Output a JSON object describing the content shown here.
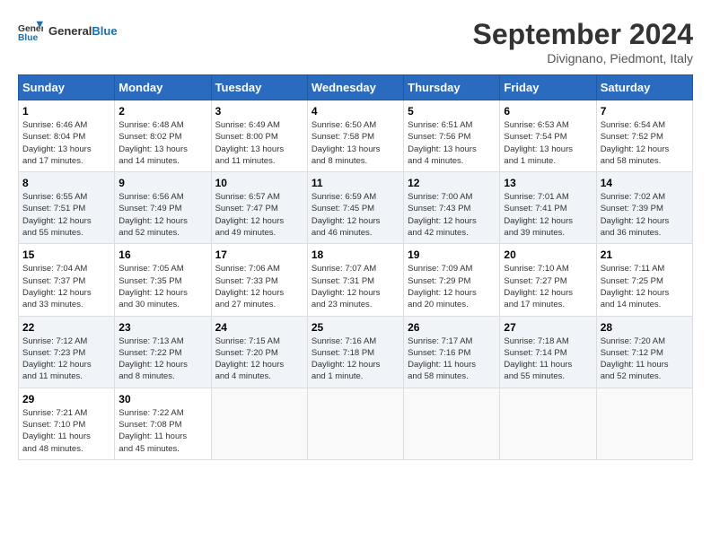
{
  "header": {
    "logo_line1": "General",
    "logo_line2": "Blue",
    "month": "September 2024",
    "location": "Divignano, Piedmont, Italy"
  },
  "columns": [
    "Sunday",
    "Monday",
    "Tuesday",
    "Wednesday",
    "Thursday",
    "Friday",
    "Saturday"
  ],
  "rows": [
    [
      {
        "day": "1",
        "info": "Sunrise: 6:46 AM\nSunset: 8:04 PM\nDaylight: 13 hours\nand 17 minutes."
      },
      {
        "day": "2",
        "info": "Sunrise: 6:48 AM\nSunset: 8:02 PM\nDaylight: 13 hours\nand 14 minutes."
      },
      {
        "day": "3",
        "info": "Sunrise: 6:49 AM\nSunset: 8:00 PM\nDaylight: 13 hours\nand 11 minutes."
      },
      {
        "day": "4",
        "info": "Sunrise: 6:50 AM\nSunset: 7:58 PM\nDaylight: 13 hours\nand 8 minutes."
      },
      {
        "day": "5",
        "info": "Sunrise: 6:51 AM\nSunset: 7:56 PM\nDaylight: 13 hours\nand 4 minutes."
      },
      {
        "day": "6",
        "info": "Sunrise: 6:53 AM\nSunset: 7:54 PM\nDaylight: 13 hours\nand 1 minute."
      },
      {
        "day": "7",
        "info": "Sunrise: 6:54 AM\nSunset: 7:52 PM\nDaylight: 12 hours\nand 58 minutes."
      }
    ],
    [
      {
        "day": "8",
        "info": "Sunrise: 6:55 AM\nSunset: 7:51 PM\nDaylight: 12 hours\nand 55 minutes."
      },
      {
        "day": "9",
        "info": "Sunrise: 6:56 AM\nSunset: 7:49 PM\nDaylight: 12 hours\nand 52 minutes."
      },
      {
        "day": "10",
        "info": "Sunrise: 6:57 AM\nSunset: 7:47 PM\nDaylight: 12 hours\nand 49 minutes."
      },
      {
        "day": "11",
        "info": "Sunrise: 6:59 AM\nSunset: 7:45 PM\nDaylight: 12 hours\nand 46 minutes."
      },
      {
        "day": "12",
        "info": "Sunrise: 7:00 AM\nSunset: 7:43 PM\nDaylight: 12 hours\nand 42 minutes."
      },
      {
        "day": "13",
        "info": "Sunrise: 7:01 AM\nSunset: 7:41 PM\nDaylight: 12 hours\nand 39 minutes."
      },
      {
        "day": "14",
        "info": "Sunrise: 7:02 AM\nSunset: 7:39 PM\nDaylight: 12 hours\nand 36 minutes."
      }
    ],
    [
      {
        "day": "15",
        "info": "Sunrise: 7:04 AM\nSunset: 7:37 PM\nDaylight: 12 hours\nand 33 minutes."
      },
      {
        "day": "16",
        "info": "Sunrise: 7:05 AM\nSunset: 7:35 PM\nDaylight: 12 hours\nand 30 minutes."
      },
      {
        "day": "17",
        "info": "Sunrise: 7:06 AM\nSunset: 7:33 PM\nDaylight: 12 hours\nand 27 minutes."
      },
      {
        "day": "18",
        "info": "Sunrise: 7:07 AM\nSunset: 7:31 PM\nDaylight: 12 hours\nand 23 minutes."
      },
      {
        "day": "19",
        "info": "Sunrise: 7:09 AM\nSunset: 7:29 PM\nDaylight: 12 hours\nand 20 minutes."
      },
      {
        "day": "20",
        "info": "Sunrise: 7:10 AM\nSunset: 7:27 PM\nDaylight: 12 hours\nand 17 minutes."
      },
      {
        "day": "21",
        "info": "Sunrise: 7:11 AM\nSunset: 7:25 PM\nDaylight: 12 hours\nand 14 minutes."
      }
    ],
    [
      {
        "day": "22",
        "info": "Sunrise: 7:12 AM\nSunset: 7:23 PM\nDaylight: 12 hours\nand 11 minutes."
      },
      {
        "day": "23",
        "info": "Sunrise: 7:13 AM\nSunset: 7:22 PM\nDaylight: 12 hours\nand 8 minutes."
      },
      {
        "day": "24",
        "info": "Sunrise: 7:15 AM\nSunset: 7:20 PM\nDaylight: 12 hours\nand 4 minutes."
      },
      {
        "day": "25",
        "info": "Sunrise: 7:16 AM\nSunset: 7:18 PM\nDaylight: 12 hours\nand 1 minute."
      },
      {
        "day": "26",
        "info": "Sunrise: 7:17 AM\nSunset: 7:16 PM\nDaylight: 11 hours\nand 58 minutes."
      },
      {
        "day": "27",
        "info": "Sunrise: 7:18 AM\nSunset: 7:14 PM\nDaylight: 11 hours\nand 55 minutes."
      },
      {
        "day": "28",
        "info": "Sunrise: 7:20 AM\nSunset: 7:12 PM\nDaylight: 11 hours\nand 52 minutes."
      }
    ],
    [
      {
        "day": "29",
        "info": "Sunrise: 7:21 AM\nSunset: 7:10 PM\nDaylight: 11 hours\nand 48 minutes."
      },
      {
        "day": "30",
        "info": "Sunrise: 7:22 AM\nSunset: 7:08 PM\nDaylight: 11 hours\nand 45 minutes."
      },
      {
        "day": "",
        "info": ""
      },
      {
        "day": "",
        "info": ""
      },
      {
        "day": "",
        "info": ""
      },
      {
        "day": "",
        "info": ""
      },
      {
        "day": "",
        "info": ""
      }
    ]
  ]
}
